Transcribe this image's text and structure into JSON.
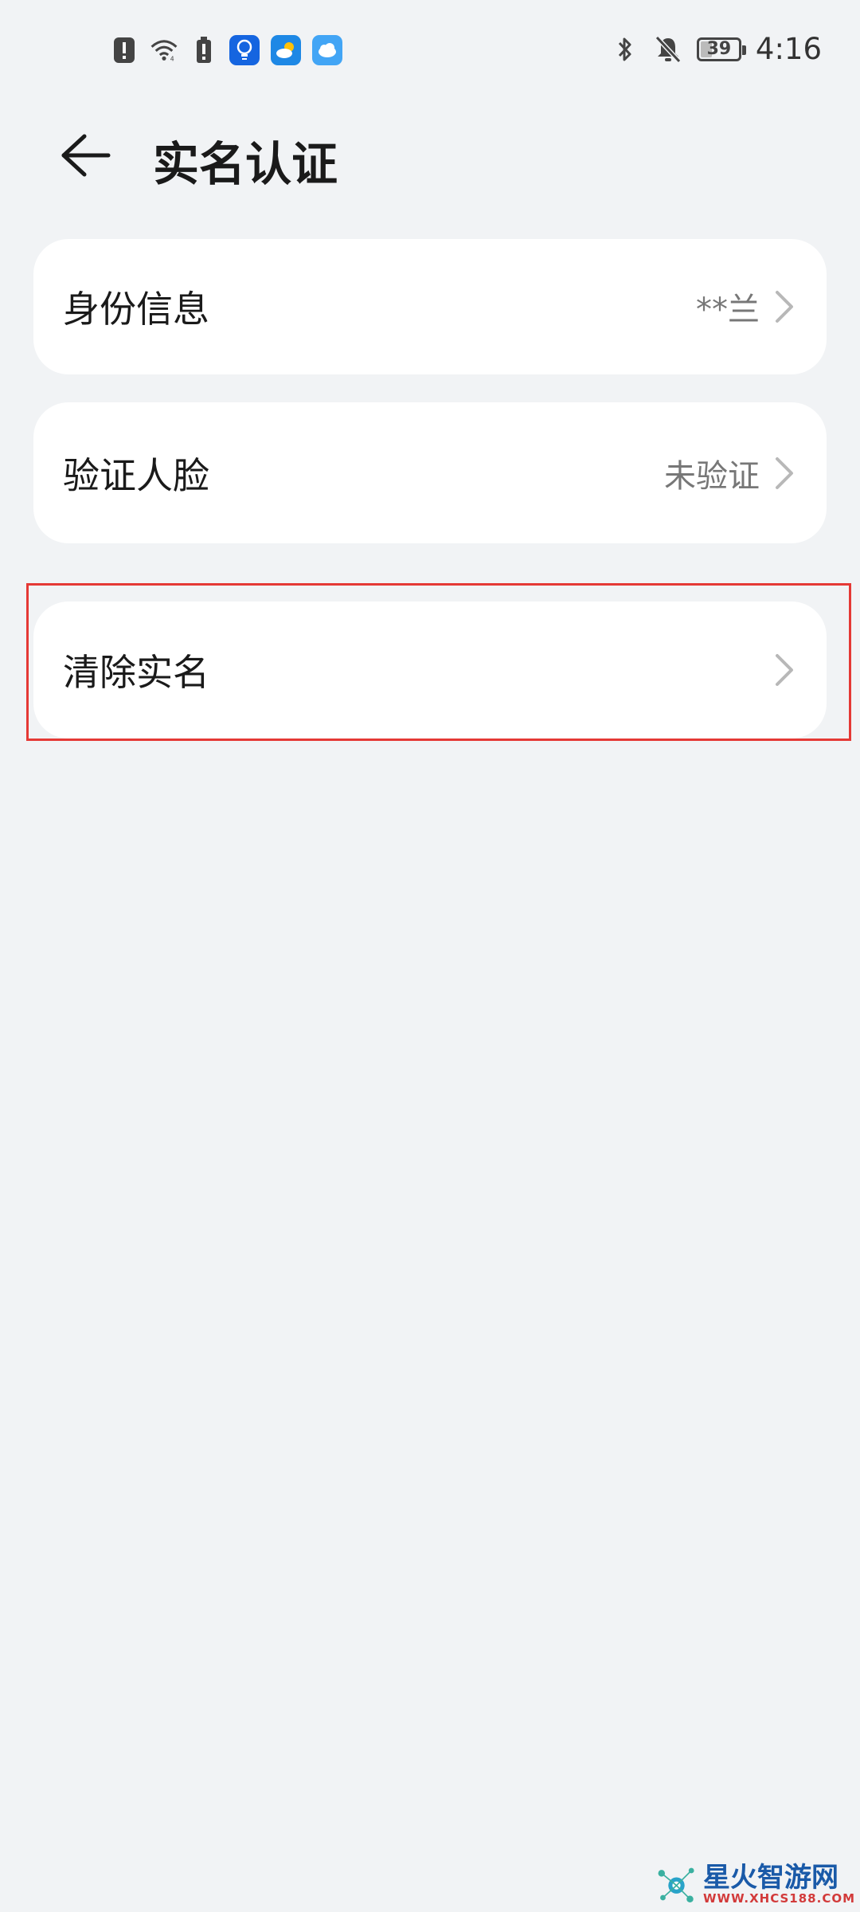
{
  "status_bar": {
    "time": "4:16",
    "battery_level": "39",
    "left_icons": [
      "alert-icon",
      "wifi-icon",
      "battery-alert-icon",
      "bulb-app-icon",
      "weather-app-icon",
      "cloud-app-icon"
    ],
    "right_icons": [
      "bluetooth-icon",
      "bell-muted-icon",
      "battery-icon"
    ]
  },
  "header": {
    "title": "实名认证",
    "back_icon": "back-arrow-icon"
  },
  "items": [
    {
      "label": "身份信息",
      "value": "**兰"
    },
    {
      "label": "验证人脸",
      "value": "未验证"
    },
    {
      "label": "清除实名",
      "value": ""
    }
  ],
  "watermark": {
    "brand": "星火智游网",
    "url": "WWW.XHCS188.COM"
  },
  "colors": {
    "background": "#f1f3f5",
    "card": "#ffffff",
    "highlight": "#e53935",
    "secondary_text": "#777777"
  }
}
